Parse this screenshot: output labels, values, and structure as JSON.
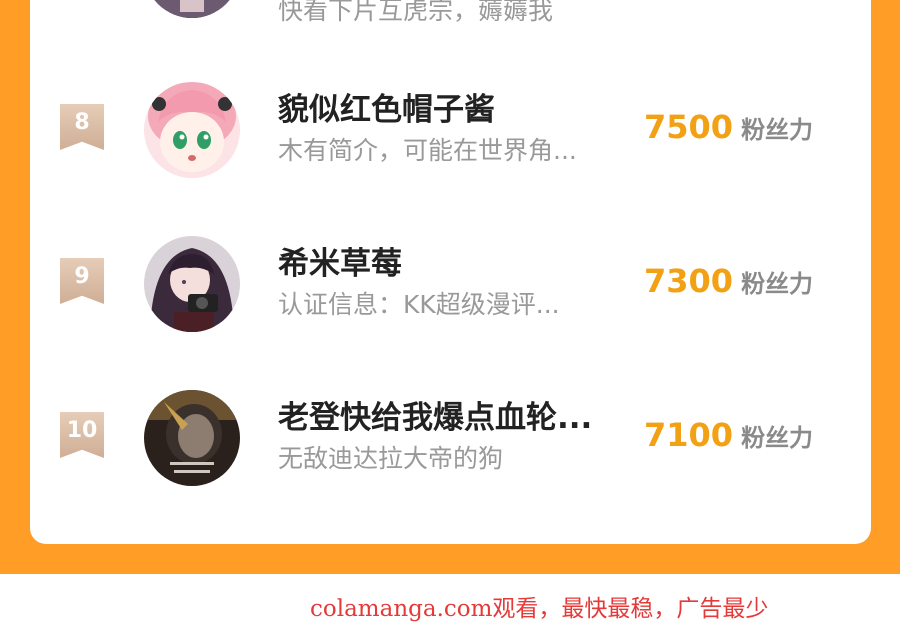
{
  "colors": {
    "frame": "#ff9d26",
    "card": "#ffffff",
    "fans_value": "#f2a114",
    "fans_unit": "#8a8a8a",
    "name": "#222222",
    "desc": "#999999",
    "rank_badge": "#d9bca5",
    "watermark": "#e43a3a"
  },
  "partial_row": {
    "desc": "快看下片互虎宗，薅薅我"
  },
  "ranking": [
    {
      "rank": "8",
      "name": "貌似红色帽子酱",
      "desc": "木有简介，可能在世界角...",
      "fans": "7500",
      "fans_unit": "粉丝力",
      "avatar_icon": "anime-girl-pink-hair-avatar"
    },
    {
      "rank": "9",
      "name": "希米草莓",
      "desc": "认证信息：KK超级漫评...",
      "fans": "7300",
      "fans_unit": "粉丝力",
      "avatar_icon": "anime-girl-camera-avatar"
    },
    {
      "rank": "10",
      "name": "老登快给我爆点血轮...",
      "desc": "无敌迪达拉大帝的狗",
      "fans": "7100",
      "fans_unit": "粉丝力",
      "avatar_icon": "dark-anime-scene-avatar"
    }
  ],
  "watermark": "colamanga.com观看，最快最稳，广告最少"
}
